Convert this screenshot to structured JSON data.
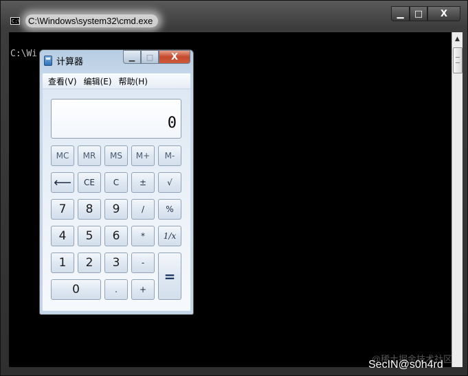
{
  "cmd": {
    "title": "C:\\Windows\\system32\\cmd.exe",
    "icon": "cmd-icon",
    "icon_text": "C:\\",
    "prompt_text": "C:\\Wi",
    "controls": {
      "minimize": "▁",
      "maximize": "□",
      "close": "X"
    }
  },
  "calculator": {
    "title": "计算器",
    "controls": {
      "minimize": "▁",
      "maximize": "□",
      "close": "X"
    },
    "menu": [
      "查看(V)",
      "编辑(E)",
      "帮助(H)"
    ],
    "display": "0",
    "buttons": {
      "mc": "MC",
      "mr": "MR",
      "ms": "MS",
      "mplus": "M+",
      "mminus": "M-",
      "back": "⟵",
      "ce": "CE",
      "c": "C",
      "plusminus": "±",
      "sqrt": "√",
      "d7": "7",
      "d8": "8",
      "d9": "9",
      "div": "/",
      "pct": "%",
      "d4": "4",
      "d5": "5",
      "d6": "6",
      "mul": "*",
      "inv": "1/x",
      "d1": "1",
      "d2": "2",
      "d3": "3",
      "sub": "-",
      "eq": "=",
      "d0": "0",
      "dot": ".",
      "add": "+"
    }
  },
  "watermark": {
    "site": "@稀土掘金技术社区",
    "author": "SecIN@s0h4rd"
  }
}
